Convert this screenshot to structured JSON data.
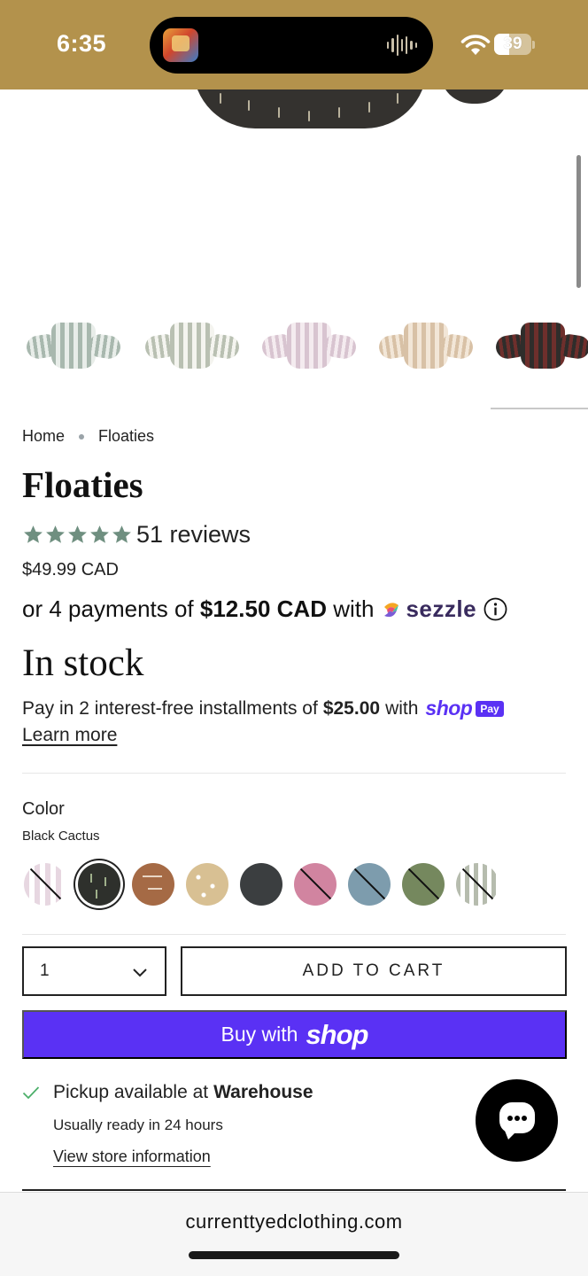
{
  "status_bar": {
    "time": "6:35",
    "battery": "39"
  },
  "breadcrumb": {
    "home": "Home",
    "current": "Floaties"
  },
  "product": {
    "title": "Floaties",
    "rating": 5,
    "reviews": "51 reviews",
    "price": "$49.99 CAD",
    "sezzle": {
      "prefix": "or 4 payments of ",
      "amount": "$12.50 CAD",
      "suffix": " with",
      "brand": "sezzle"
    },
    "stock": "In stock",
    "shop_pay": {
      "prefix": "Pay in 2 interest-free installments of",
      "amount": "$25.00",
      "suffix": "with",
      "brand": "shop",
      "badge": "Pay"
    },
    "learn_more": "Learn more"
  },
  "thumbnails": [
    {
      "color": "#a8b8ae",
      "accent": "#e8ede9"
    },
    {
      "color": "#b9c0b2",
      "accent": "#f4f4ef"
    },
    {
      "color": "#d8c4d0",
      "accent": "#f4ebef"
    },
    {
      "color": "#d8c1a6",
      "accent": "#f2e6d7"
    },
    {
      "color": "#2f2d2b",
      "accent": "#6e2f2c"
    }
  ],
  "color_option": {
    "label": "Color",
    "selected": "Black Cactus",
    "swatches": [
      {
        "name": "Purple Stripe",
        "color": "#e7d7e1",
        "sold_out": true
      },
      {
        "name": "Black Cactus",
        "color": "#2e302c",
        "sold_out": false
      },
      {
        "name": "Rust Desert",
        "color": "#a56a45",
        "sold_out": false
      },
      {
        "name": "Sand Dots",
        "color": "#d8c093",
        "sold_out": false
      },
      {
        "name": "Charcoal",
        "color": "#3b3e40",
        "sold_out": false
      },
      {
        "name": "Rose",
        "color": "#d184a0",
        "sold_out": true
      },
      {
        "name": "Dusty Blue",
        "color": "#7d9cad",
        "sold_out": true
      },
      {
        "name": "Sage",
        "color": "#75885e",
        "sold_out": true
      },
      {
        "name": "Sage Stripe",
        "color": "#b6bcae",
        "sold_out": true
      }
    ]
  },
  "quantity": {
    "value": "1"
  },
  "buttons": {
    "add_to_cart": "ADD TO CART",
    "buy_with": "Buy with",
    "buy_brand": "shop"
  },
  "pickup": {
    "prefix": "Pickup available at",
    "location": "Warehouse",
    "ready": "Usually ready in 24 hours",
    "store_info": "View store information"
  },
  "browser": {
    "url": "currenttyedclothing.com"
  },
  "colors": {
    "status_bar": "#b3924c",
    "star": "#6f8f80",
    "shop_purple": "#5a31f4",
    "check": "#4caf6a"
  }
}
